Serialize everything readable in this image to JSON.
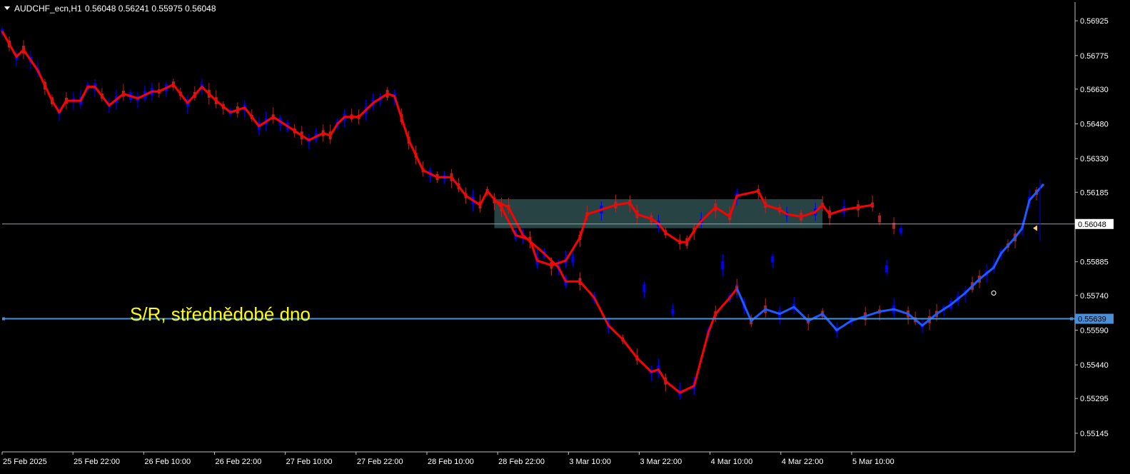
{
  "window": {
    "symbol_label": "AUDCHF_ecn,H1",
    "ohlc": "0.56048 0.56241 0.55975 0.56048"
  },
  "colors": {
    "background": "#000000",
    "frame": "#c0c0c0",
    "bull_candle": "#0000ff",
    "bear_candle": "#a52a2a",
    "trend_line_red": "#ff0000",
    "trend_line_blue": "#1e5aff",
    "level_line": "#4a90d9",
    "zone_fill": "#2f4f4f",
    "annotation_text": "#ffff00",
    "axis_text": "#ffffff",
    "current_price_box_fill": "#ffffff",
    "current_price_box_text": "#000000",
    "level_box_fill": "#4a90d9",
    "level_box_text": "#000000"
  },
  "annotation": {
    "text": "S/R, střednědobé dno"
  },
  "chart_data": {
    "type": "line",
    "title": "AUDCHF_ecn,H1",
    "timeframe": "H1",
    "xlabel": "",
    "ylabel": "",
    "ylim": [
      0.5508,
      0.5699
    ],
    "y_ticks": [
      "0.56925",
      "0.56775",
      "0.56630",
      "0.56480",
      "0.56330",
      "0.56185",
      "0.55885",
      "0.55740",
      "0.55590",
      "0.55440",
      "0.55295",
      "0.55145"
    ],
    "x_ticks": [
      "25 Feb 2025",
      "25 Feb 22:00",
      "26 Feb 10:00",
      "26 Feb 22:00",
      "27 Feb 10:00",
      "27 Feb 22:00",
      "28 Feb 10:00",
      "28 Feb 22:00",
      "3 Mar 10:00",
      "3 Mar 22:00",
      "4 Mar 10:00",
      "4 Mar 22:00",
      "5 Mar 10:00"
    ],
    "x_index_range": [
      0,
      126
    ],
    "current_price": {
      "label": "0.56048",
      "value": 0.56048
    },
    "horizontal_levels": [
      {
        "label": "0.55639",
        "value": 0.55639
      }
    ],
    "zone": {
      "x_start": 69,
      "x_end": 115,
      "y_low": 0.5603,
      "y_high": 0.56155
    },
    "grid": false,
    "series": [
      {
        "name": "",
        "color": "#ff0000",
        "points": [
          [
            0,
            0.5688
          ],
          [
            2,
            0.5677
          ],
          [
            3,
            0.568
          ],
          [
            5,
            0.5671
          ],
          [
            7,
            0.5658
          ],
          [
            8,
            0.5653
          ],
          [
            9,
            0.5658
          ],
          [
            11,
            0.5658
          ],
          [
            12,
            0.5664
          ],
          [
            13,
            0.5664
          ],
          [
            15,
            0.5656
          ],
          [
            17,
            0.5661
          ],
          [
            18,
            0.566
          ],
          [
            19,
            0.5659
          ],
          [
            21,
            0.5662
          ],
          [
            22,
            0.5662
          ],
          [
            24,
            0.5665
          ],
          [
            26,
            0.5657
          ],
          [
            28,
            0.5664
          ],
          [
            30,
            0.5658
          ],
          [
            32,
            0.5653
          ],
          [
            34,
            0.5655
          ],
          [
            36,
            0.5647
          ],
          [
            38,
            0.5651
          ],
          [
            40,
            0.5647
          ],
          [
            43,
            0.5641
          ],
          [
            45,
            0.5644
          ],
          [
            46,
            0.5643
          ],
          [
            47,
            0.5648
          ],
          [
            48,
            0.5651
          ],
          [
            50,
            0.5651
          ],
          [
            52,
            0.5657
          ],
          [
            54,
            0.5661
          ],
          [
            55,
            0.566
          ],
          [
            57,
            0.5641
          ],
          [
            59,
            0.5628
          ],
          [
            61,
            0.5625
          ],
          [
            63,
            0.5625
          ],
          [
            65,
            0.5617
          ],
          [
            67,
            0.5613
          ],
          [
            68,
            0.5619
          ],
          [
            70,
            0.5612
          ],
          [
            72,
            0.56
          ],
          [
            74,
            0.5598
          ],
          [
            75,
            0.5589
          ],
          [
            77,
            0.5587
          ],
          [
            79,
            0.5589
          ],
          [
            81,
            0.5599
          ],
          [
            82,
            0.5609
          ],
          [
            84,
            0.5611
          ],
          [
            86,
            0.5613
          ],
          [
            88,
            0.5614
          ],
          [
            89,
            0.5609
          ],
          [
            91,
            0.5607
          ],
          [
            92,
            0.5605
          ],
          [
            93,
            0.5601
          ],
          [
            95,
            0.5597
          ],
          [
            96,
            0.5597
          ],
          [
            97,
            0.5602
          ],
          [
            98,
            0.5606
          ],
          [
            100,
            0.5612
          ],
          [
            102,
            0.5608
          ],
          [
            103,
            0.5617
          ],
          [
            106,
            0.5619
          ],
          [
            107,
            0.5613
          ],
          [
            109,
            0.5611
          ],
          [
            110,
            0.5609
          ],
          [
            112,
            0.5608
          ],
          [
            114,
            0.561
          ],
          [
            115,
            0.5613
          ],
          [
            116,
            0.5609
          ],
          [
            118,
            0.5611
          ],
          [
            120,
            0.5612
          ],
          [
            122,
            0.5613
          ],
          [
            123,
            0.5607
          ],
          [
            125,
            0.5604
          ],
          [
            126,
            0.5602
          ]
        ],
        "points_tail": [
          [
            69,
            0.5615
          ],
          [
            71,
            0.5612
          ],
          [
            73,
            0.56
          ],
          [
            76,
            0.5592
          ],
          [
            78,
            0.5586
          ],
          [
            79,
            0.558
          ],
          [
            81,
            0.558
          ],
          [
            83,
            0.5573
          ],
          [
            85,
            0.5561
          ],
          [
            87,
            0.5555
          ],
          [
            89,
            0.5547
          ],
          [
            91,
            0.5541
          ],
          [
            92,
            0.5542
          ],
          [
            93,
            0.5537
          ],
          [
            95,
            0.5532
          ],
          [
            97,
            0.5535
          ],
          [
            99,
            0.5558
          ],
          [
            100,
            0.5566
          ],
          [
            102,
            0.5573
          ],
          [
            103,
            0.5577
          ]
        ]
      },
      {
        "name": "",
        "color": "#1e5aff",
        "points": [
          [
            103,
            0.5577
          ],
          [
            105,
            0.5563
          ],
          [
            107,
            0.5568
          ],
          [
            109,
            0.5566
          ],
          [
            111,
            0.5569
          ],
          [
            113,
            0.5563
          ],
          [
            115,
            0.5566
          ],
          [
            117,
            0.5559
          ],
          [
            119,
            0.5563
          ],
          [
            121,
            0.5565
          ],
          [
            123,
            0.5567
          ],
          [
            125,
            0.5568
          ],
          [
            127,
            0.5566
          ],
          [
            129,
            0.5561
          ],
          [
            131,
            0.5566
          ],
          [
            133,
            0.557
          ],
          [
            135,
            0.5575
          ],
          [
            137,
            0.5581
          ],
          [
            139,
            0.5586
          ],
          [
            140,
            0.5592
          ],
          [
            142,
            0.5599
          ],
          [
            143,
            0.5603
          ],
          [
            144,
            0.5615
          ],
          [
            146,
            0.5622
          ]
        ]
      }
    ]
  }
}
